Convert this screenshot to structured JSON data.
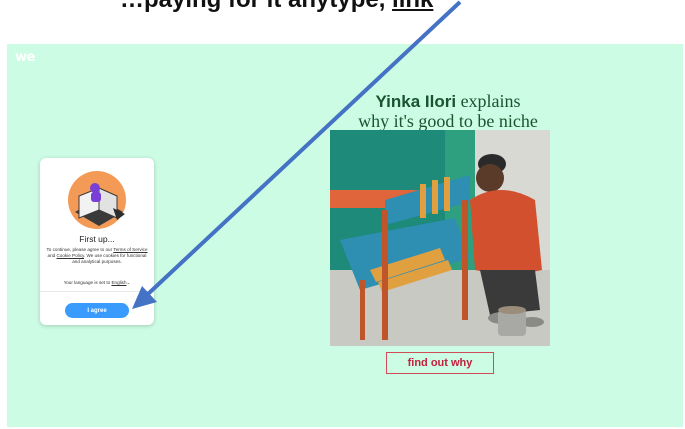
{
  "caption": {
    "before": "…paying for it anytype, ",
    "link": "link"
  },
  "site": {
    "logo": "we"
  },
  "headline": {
    "name": "Yinka Ilori",
    "line1_rest": " explains",
    "line2": "why it's good to be niche"
  },
  "cta": {
    "label": "find out why"
  },
  "consent": {
    "title": "First up...",
    "body_pre": "To continue, please agree to our ",
    "terms_link": "Terms of Service",
    "body_and": " and ",
    "cookie_link": "Cookie Policy",
    "body_post": ". We use cookies for functional and analytical purposes.",
    "lang_text": "Your language is set to ",
    "lang_value": "English",
    "agree_label": "I agree"
  },
  "colors": {
    "page_bg": "#ccfce4",
    "headline": "#1a5330",
    "cta": "#c2203b",
    "agree": "#3a9bff",
    "arrow": "#4472c4"
  }
}
